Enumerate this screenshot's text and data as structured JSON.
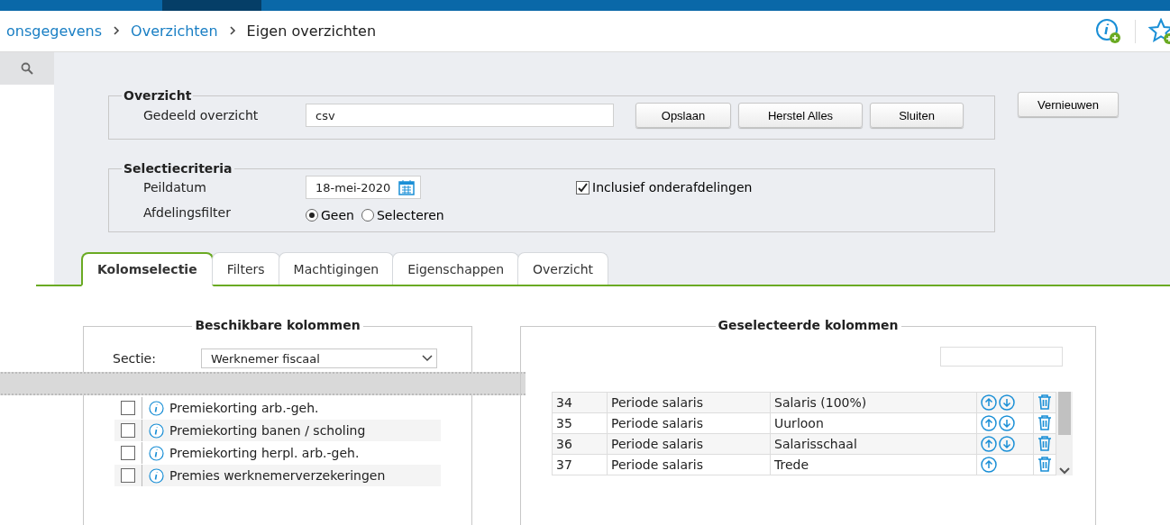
{
  "breadcrumb": [
    {
      "label": "onsgegevens",
      "link": true
    },
    {
      "label": "Overzichten",
      "link": true
    },
    {
      "label": "Eigen overzichten",
      "link": false
    }
  ],
  "overzicht": {
    "legend": "Overzicht",
    "label": "Gedeeld overzicht",
    "value": "csv",
    "buttons": [
      "Opslaan",
      "Herstel Alles",
      "Sluiten"
    ]
  },
  "refresh_button": "Vernieuwen",
  "selectiecriteria": {
    "legend": "Selectiecriteria",
    "peildatum": {
      "label": "Peildatum",
      "value": "18-mei-2020"
    },
    "afdelingsfilter": {
      "label": "Afdelingsfilter",
      "options": [
        {
          "label": "Geen",
          "selected": true
        },
        {
          "label": "Selecteren",
          "selected": false
        }
      ]
    },
    "inclusief": {
      "label": "Inclusief onderafdelingen",
      "checked": true
    }
  },
  "tabs": [
    {
      "label": "Kolomselectie",
      "selected": true
    },
    {
      "label": "Filters",
      "selected": false
    },
    {
      "label": "Machtigingen",
      "selected": false
    },
    {
      "label": "Eigenschappen",
      "selected": false
    },
    {
      "label": "Overzicht",
      "selected": false
    }
  ],
  "available": {
    "legend": "Beschikbare kolommen",
    "sectie": {
      "label": "Sectie:",
      "value": "Werknemer fiscaal"
    },
    "items": [
      {
        "label": "Premiekorting arb.-geh.",
        "checked": false
      },
      {
        "label": "Premiekorting banen / scholing",
        "checked": false
      },
      {
        "label": "Premiekorting herpl. arb.-geh.",
        "checked": false
      },
      {
        "label": "Premies werknemerverzekeringen",
        "checked": false
      }
    ]
  },
  "selected_columns": {
    "legend": "Geselecteerde kolommen",
    "rows": [
      {
        "number": "34",
        "group": "Periode salaris",
        "column": "Salaris (100%)",
        "up": true,
        "down": true
      },
      {
        "number": "35",
        "group": "Periode salaris",
        "column": "Uurloon",
        "up": true,
        "down": true
      },
      {
        "number": "36",
        "group": "Periode salaris",
        "column": "Salarisschaal",
        "up": true,
        "down": true
      },
      {
        "number": "37",
        "group": "Periode salaris",
        "column": "Trede",
        "up": true,
        "down": false
      }
    ]
  }
}
